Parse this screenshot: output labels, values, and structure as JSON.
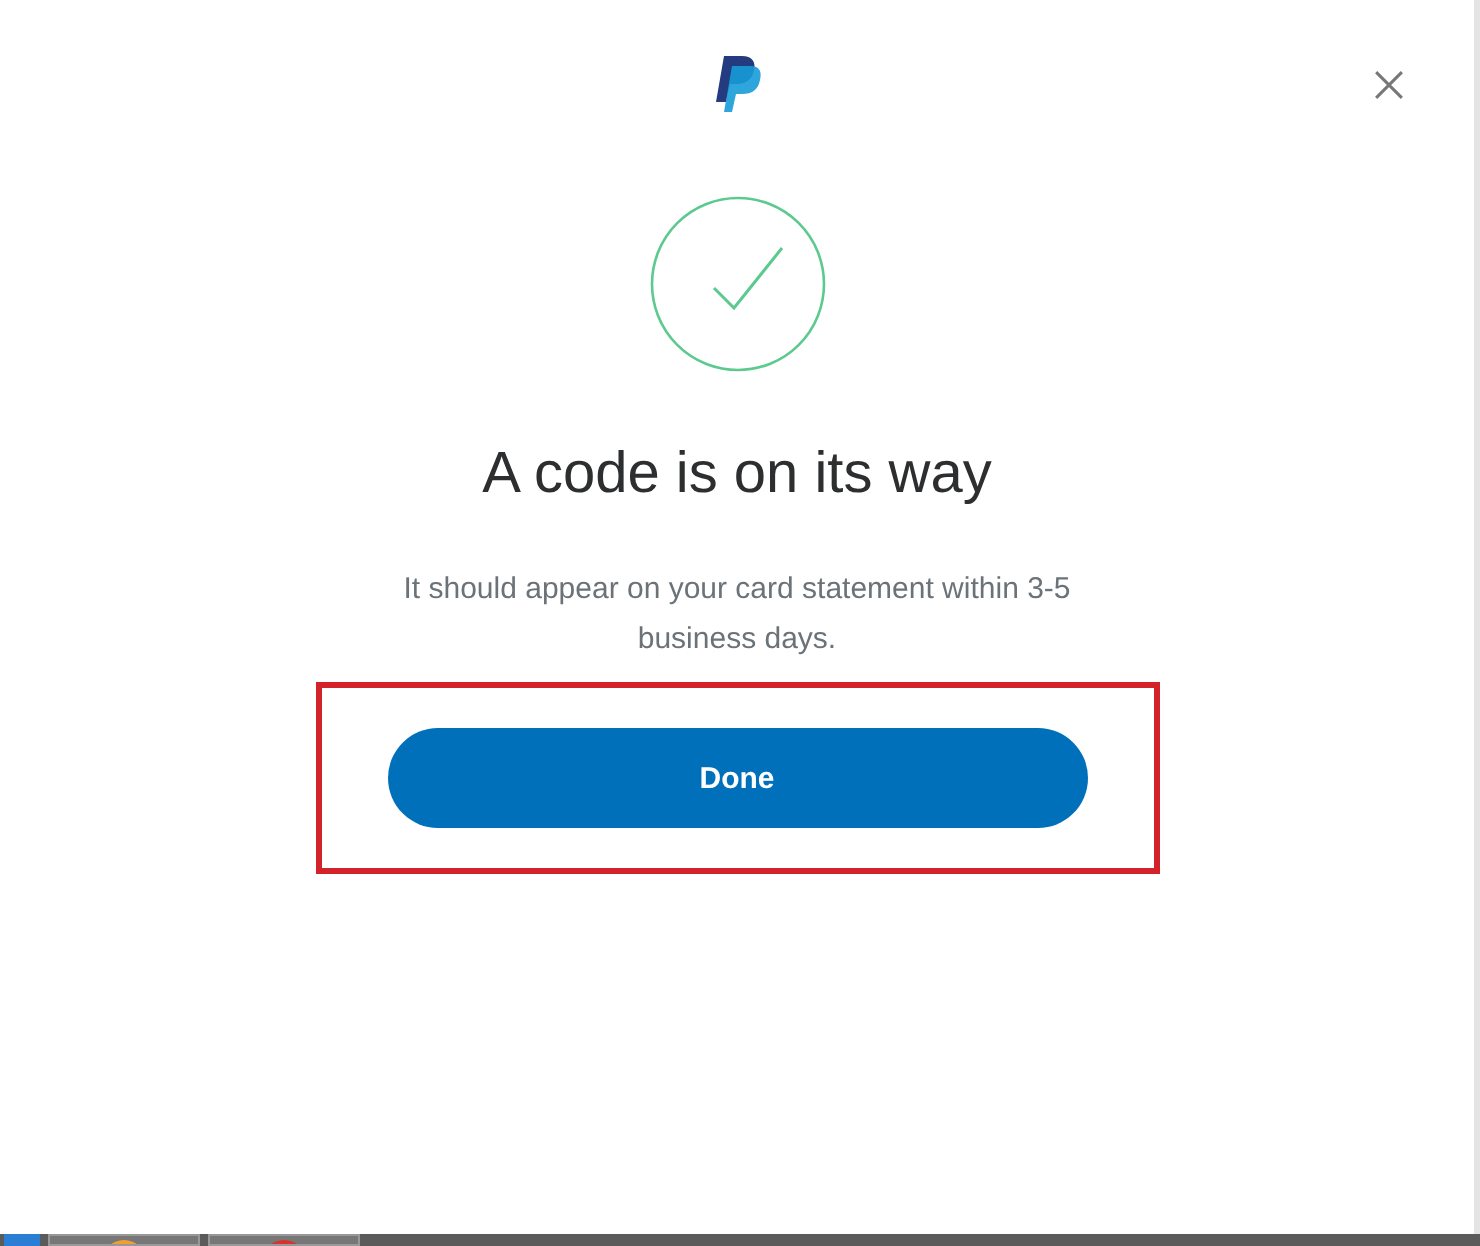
{
  "dialog": {
    "heading": "A code is on its way",
    "message": "It should appear on your card statement within 3-5 business days.",
    "button": {
      "label": "Done"
    }
  }
}
